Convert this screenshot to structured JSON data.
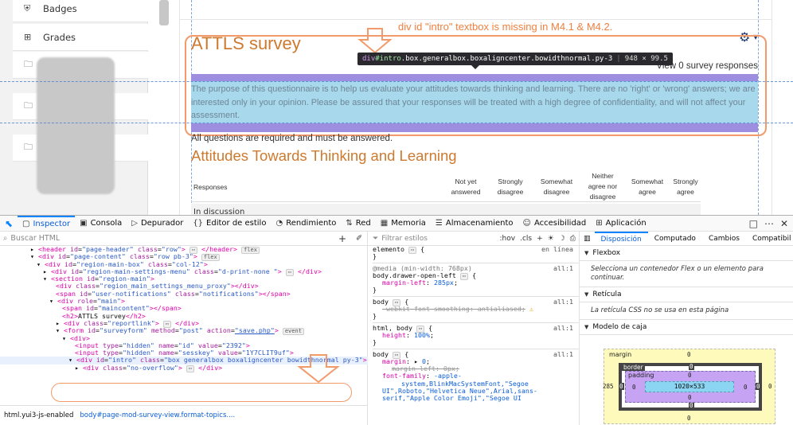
{
  "drawer": {
    "items": [
      {
        "icon": "shield-icon",
        "label": "Badges"
      },
      {
        "icon": "table-icon",
        "label": "Grades"
      },
      {
        "icon": "folder-icon",
        "label": ""
      },
      {
        "icon": "folder-icon",
        "label": ""
      },
      {
        "icon": "folder-icon",
        "label": ""
      }
    ]
  },
  "main": {
    "title": "ATTLS survey",
    "report_link": "View 0 survey responses",
    "intro_text": "The purpose of this questionnaire is to help us evaluate your attitudes towards thinking and learning. There are no 'right' or 'wrong' answers; we are interested only in your opinion. Please be assured that your responses will be treated with a high degree of confidentiality, and will not affect your assessment.",
    "required_note": "All questions are required and must be answered.",
    "section_title": "Attitudes Towards Thinking and Learning",
    "survey_headers": [
      "Responses",
      "Not yet answered",
      "Strongly disagree",
      "Somewhat disagree",
      "Neither agree nor disagree",
      "Somewhat agree",
      "Strongly agree"
    ],
    "first_row": "In discussion"
  },
  "annotation": {
    "text": "div id \"intro\"  textbox is missing in M4.1 & M4.2.",
    "color": "#f08040"
  },
  "tooltip": {
    "tag": "div",
    "id": "#intro",
    "classes": ".box.generalbox.boxaligncenter.bowidthnormal.py-3",
    "dims": "948 × 99.5"
  },
  "devtools": {
    "tabs": [
      {
        "icon": "inspector-icon",
        "label": "Inspector",
        "active": true
      },
      {
        "icon": "console-icon",
        "label": "Consola"
      },
      {
        "icon": "debugger-icon",
        "label": "Depurador"
      },
      {
        "icon": "style-editor-icon",
        "label": "Editor de estilo"
      },
      {
        "icon": "performance-icon",
        "label": "Rendimiento"
      },
      {
        "icon": "memory-icon",
        "label": "Memoria"
      },
      {
        "icon": "storage-icon",
        "label": "Almacenamiento"
      },
      {
        "icon": "accessibility-icon",
        "label": "Accesibilidad"
      },
      {
        "icon": "application-icon",
        "label": "Aplicación"
      }
    ],
    "search_placeholder": "Buscar HTML",
    "breadcrumbs": [
      "html.yui3-js-enabled",
      "body#page-mod-survey-view.format-topics...."
    ],
    "rules_filter_placeholder": "Filtrar estilos",
    "rules_toggles": [
      ":hov",
      ".cls"
    ],
    "layout_tabs": [
      "Disposición",
      "Computado",
      "Cambios",
      "Compatibil"
    ],
    "layout_sections": {
      "flexbox_title": "Flexbox",
      "flexbox_msg": "Selecciona un contenedor Flex o un elemento para continuar.",
      "grid_title": "Retícula",
      "grid_msg": "La retícula CSS no se usa en esta página",
      "boxmodel_title": "Modelo de caja"
    },
    "boxmodel": {
      "margin_label": "margin",
      "border_label": "border",
      "padding_label": "padding",
      "content": "1020×533",
      "margin_top": "0",
      "margin_left": "285",
      "margin_right": "0",
      "margin_bottom": "0",
      "border_top": "0",
      "border_left": "0",
      "border_right": "0",
      "border_bottom": "0",
      "padding_top": "0",
      "padding_left": "0",
      "padding_right": "0",
      "padding_bottom": "0"
    }
  }
}
